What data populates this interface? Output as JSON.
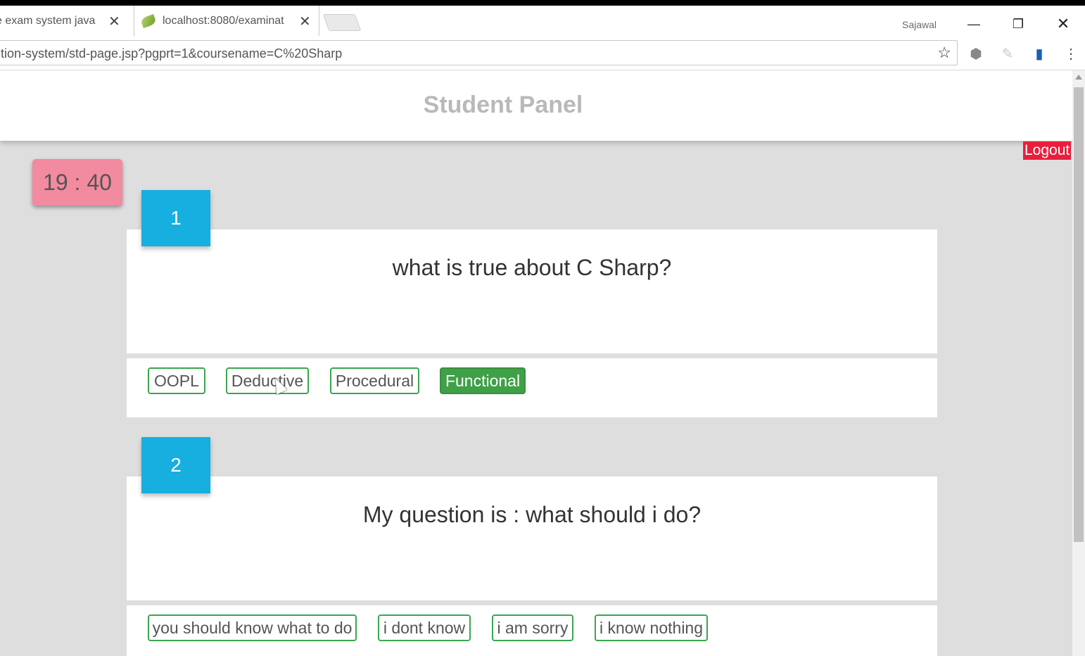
{
  "browser": {
    "tabs": [
      {
        "label": "e exam system java"
      },
      {
        "label": "localhost:8080/examinat"
      }
    ],
    "profile_name": "Sajawal",
    "url": "tion-system/std-page.jsp?pgprt=1&coursename=C%20Sharp",
    "window_controls": {
      "minimize": "—",
      "restore": "❐",
      "close": "✕"
    }
  },
  "page": {
    "header_title": "Student Panel",
    "logout_label": "Logout",
    "timer": "19 : 40"
  },
  "questions": [
    {
      "number": "1",
      "text": "what is true about C Sharp?",
      "options": [
        "OOPL",
        "Deductive",
        "Procedural",
        "Functional"
      ],
      "selected": "Functional"
    },
    {
      "number": "2",
      "text": "My question is : what should i do?",
      "options": [
        "you should know what to do",
        "i dont know",
        "i am sorry",
        "i know nothing"
      ]
    }
  ],
  "colors": {
    "accent": "#17aee0",
    "selected": "#3fa047",
    "timer": "#f28aa0",
    "logout": "#e81f3c"
  }
}
